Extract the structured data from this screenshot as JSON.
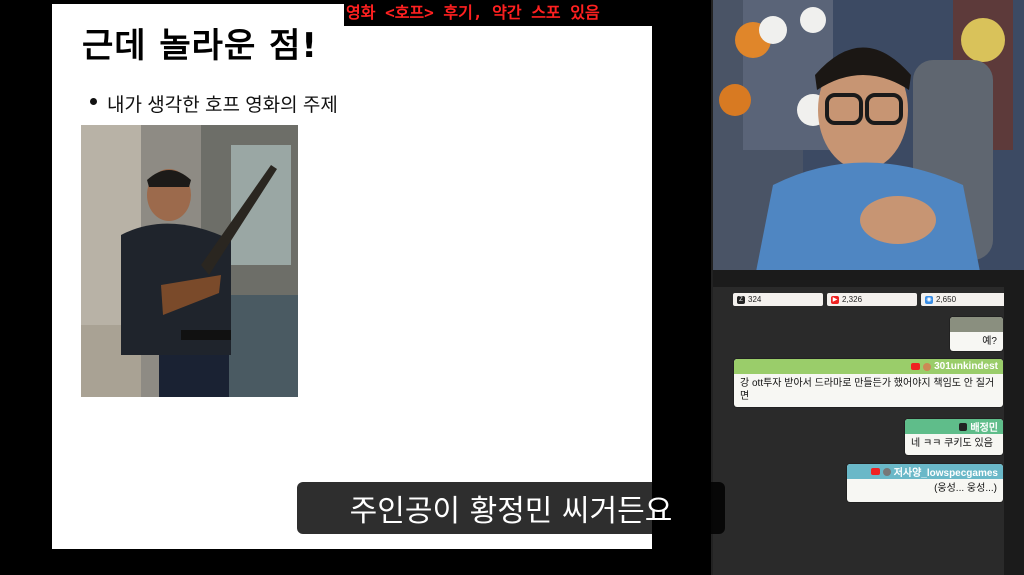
{
  "overlay": {
    "title_banner": "영화 <호프> 후기, 약간 스포 있음"
  },
  "slide": {
    "title": "근데 놀라운 점!",
    "bullet": "내가 생각한 호프 영화의 주제"
  },
  "subtitle": "주인공이 황정민 씨거든요",
  "chat": {
    "stats": [
      {
        "icon": "chzzk-icon",
        "value": "324"
      },
      {
        "icon": "youtube-icon",
        "value": "2,326"
      },
      {
        "icon": "viewer-icon",
        "value": "2,650"
      }
    ],
    "messages": [
      {
        "user": "",
        "text": "예?",
        "color": "#8a8f7f"
      },
      {
        "user": "301unkindest",
        "text": "강 ott투자 받아서 드라마로 만들든가 했어야지 책임도 안 질거면",
        "color": "#9acd6a"
      },
      {
        "user": "배정민",
        "text": "네 ㅋㅋ 쿠키도 있음",
        "color": "#5fbd8a"
      },
      {
        "user": "저사양_lowspecgames",
        "text": "(웅성... 웅성...)",
        "color": "#6ab8c8"
      }
    ]
  }
}
